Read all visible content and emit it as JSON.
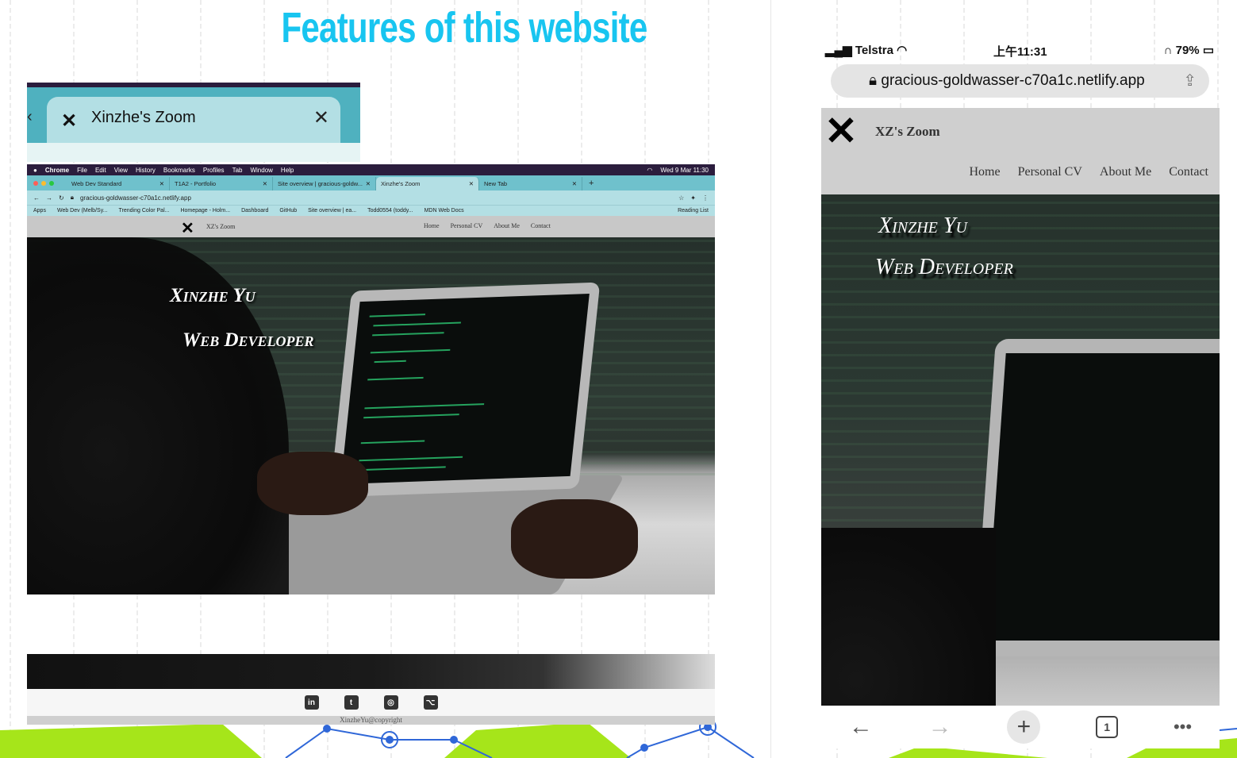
{
  "slide": {
    "title": "Features of this website"
  },
  "tab_preview": {
    "tab_title": "Xinzhe's Zoom",
    "close_glyph": "✕",
    "logo_glyph": "✕"
  },
  "desktop": {
    "menubar": [
      "Chrome",
      "File",
      "Edit",
      "View",
      "History",
      "Bookmarks",
      "Profiles",
      "Tab",
      "Window",
      "Help"
    ],
    "datetime": "Wed 9 Mar  11:30",
    "tabs": [
      "Web Dev Standard",
      "T1A2 - Portfolio",
      "Site overview | gracious-goldw...",
      "Xinzhe's Zoom",
      "New Tab"
    ],
    "active_tab_index": 3,
    "url": "gracious-goldwasser-c70a1c.netlify.app",
    "bookmarks": [
      "Apps",
      "Web Dev (Melb/Sy...",
      "Trending Color Pal...",
      "Homepage - Holm...",
      "Dashboard",
      "GitHub",
      "Site overview | ea...",
      "Todd0554 (toddy...",
      "MDN Web Docs"
    ],
    "reading_list": "Reading List",
    "site": {
      "name": "XZ's Zoom",
      "nav": [
        "Home",
        "Personal CV",
        "About Me",
        "Contact"
      ],
      "hero_name": "Xinzhe Yu",
      "hero_role": "Web Developer"
    }
  },
  "footer_preview": {
    "social": [
      "in",
      "t",
      "◎",
      "⌥"
    ],
    "copyright": "XinzheYu@copyright"
  },
  "phone": {
    "carrier": "Telstra",
    "time": "上午11:31",
    "battery": "79%",
    "url": "gracious-goldwasser-c70a1c.netlify.app",
    "site": {
      "name": "XZ's Zoom",
      "nav": [
        "Home",
        "Personal CV",
        "About Me",
        "Contact"
      ],
      "hero_name": "Xinzhe Yu",
      "hero_role": "Web Developer"
    },
    "toolbar": {
      "back": "←",
      "forward": "→",
      "new_tab": "+",
      "tab_count": "1",
      "more": "•••"
    }
  },
  "colors": {
    "title": "#18c5f0",
    "chrome_tab_bar": "#6fc1cc",
    "accent_green": "#a6e51a",
    "accent_blue": "#2f67d8"
  }
}
